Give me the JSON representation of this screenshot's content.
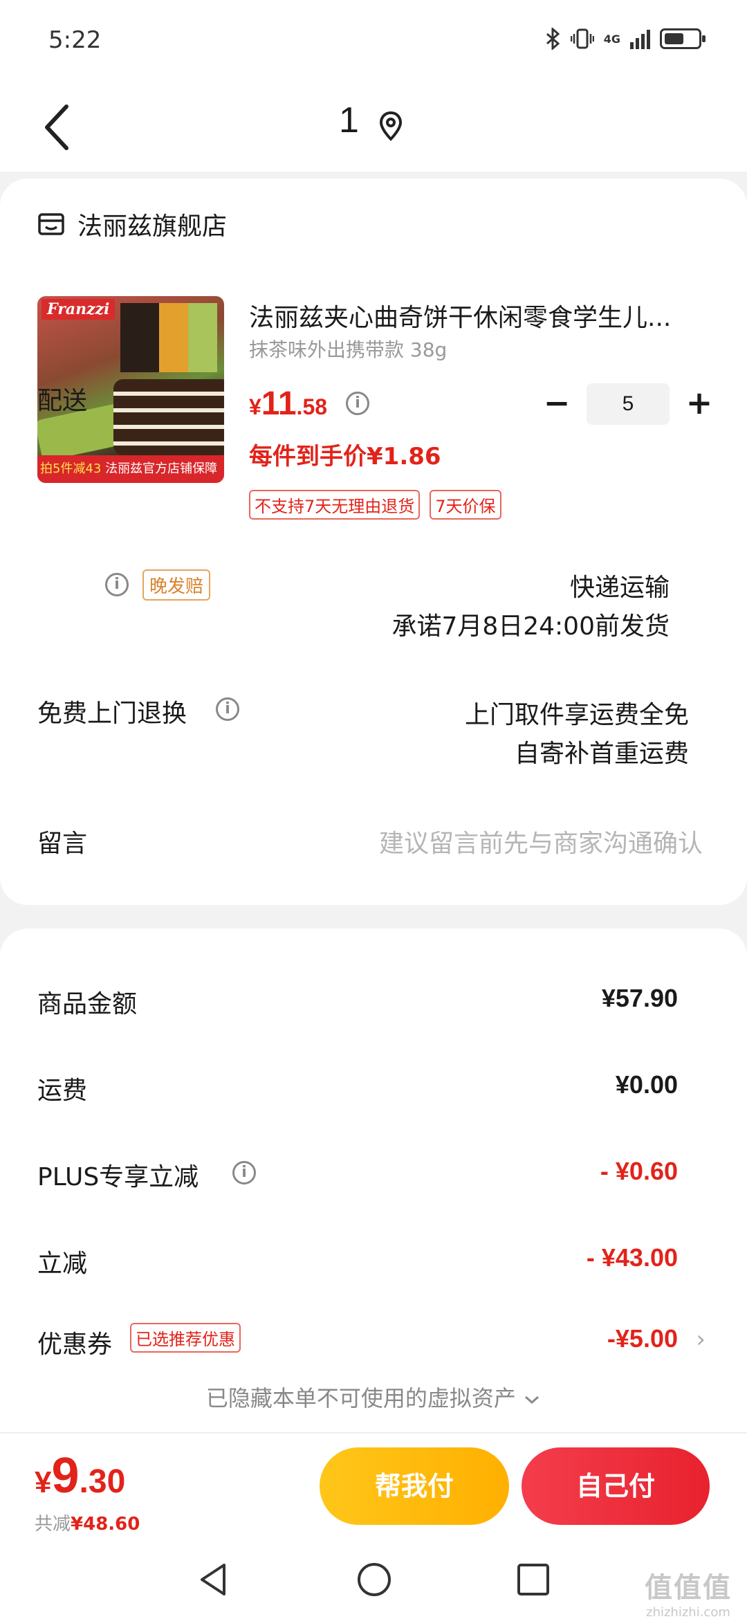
{
  "status_bar": {
    "time": "5:22",
    "network": "4G"
  },
  "nav": {
    "title": "1"
  },
  "store": {
    "name": "法丽兹旗舰店"
  },
  "product": {
    "image_brand": "Franzzi",
    "image_band_highlight": "拍5件减43",
    "image_band_text": "法丽兹官方店铺保障",
    "title": "法丽兹夹心曲奇饼干休闲零食学生儿...",
    "spec": "抹茶味外出携带款 38g",
    "price_symbol": "¥",
    "price_int": "11",
    "price_dec": ".58",
    "unit_price": "每件到手价¥1.86",
    "tags": [
      "不支持7天无理由退货",
      "7天价保"
    ],
    "quantity": "5",
    "minus_label": "−",
    "plus_label": "+"
  },
  "delivery": {
    "label": "配送",
    "badge": "晚发赔",
    "method": "快递运输",
    "promise": "承诺7月8日24:00前发货"
  },
  "returns": {
    "label": "免费上门退换",
    "line1": "上门取件享运费全免",
    "line2": "自寄补首重运费"
  },
  "remark": {
    "label": "留言",
    "placeholder": "建议留言前先与商家沟通确认"
  },
  "summary": {
    "goods_label": "商品金额",
    "goods_value": "¥57.90",
    "shipping_label": "运费",
    "shipping_value": "¥0.00",
    "plus_label": "PLUS专享立减",
    "plus_value": "- ¥0.60",
    "discount_label": "立减",
    "discount_value": "- ¥43.00",
    "coupon_label": "优惠券",
    "coupon_tag": "已选推荐优惠",
    "coupon_value": "-¥5.00",
    "hidden_note": "已隐藏本单不可使用的虚拟资产"
  },
  "checkout": {
    "total_symbol": "¥",
    "total_int": "9",
    "total_dec": ".30",
    "saved_label": "共减",
    "saved_value": "¥48.60",
    "help_pay": "帮我付",
    "self_pay": "自己付"
  },
  "watermark": {
    "mark": "值值值",
    "text": "zhizhizhi.com"
  },
  "colors": {
    "accent_red": "#e2231a",
    "help_yellow": "#ffc61a",
    "pay_red": "#e8222e"
  }
}
